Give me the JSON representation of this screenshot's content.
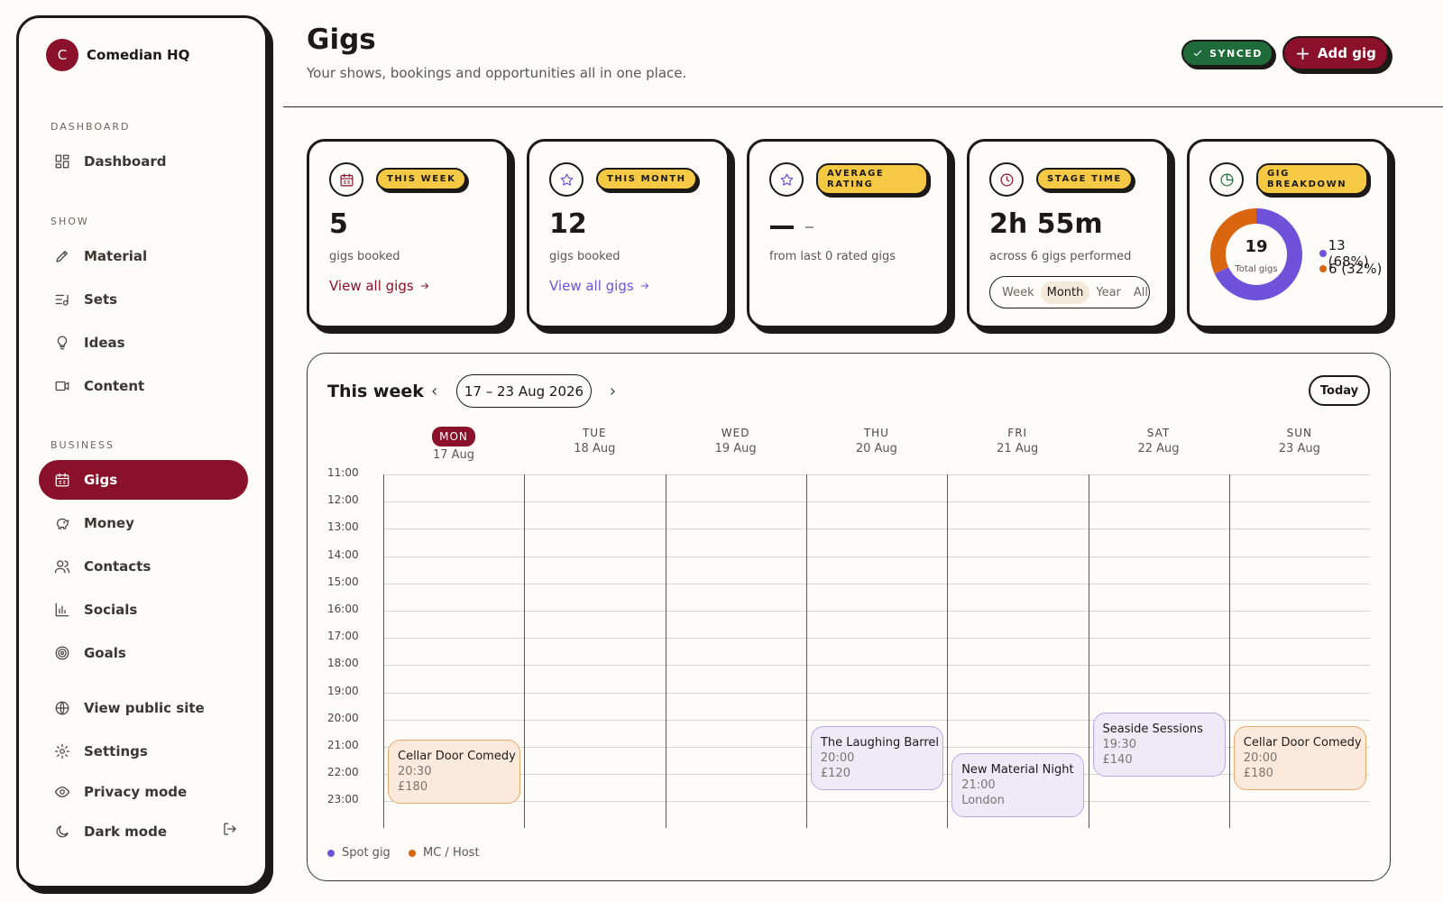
{
  "brand": {
    "initial": "C",
    "name": "Comedian HQ"
  },
  "sidebar": {
    "sections": {
      "dashboard": "DASHBOARD",
      "show": "SHOW",
      "business": "BUSINESS"
    },
    "items": {
      "dashboard": "Dashboard",
      "material": "Material",
      "sets": "Sets",
      "ideas": "Ideas",
      "content": "Content",
      "gigs": "Gigs",
      "money": "Money",
      "contacts": "Contacts",
      "socials": "Socials",
      "goals": "Goals",
      "public_site": "View public site",
      "settings": "Settings",
      "privacy": "Privacy mode",
      "dark": "Dark mode"
    },
    "active": "gigs"
  },
  "header": {
    "title": "Gigs",
    "subtitle": "Your shows, bookings and opportunities all in one place.",
    "synced": "SYNCED",
    "add_gig": "Add gig"
  },
  "cards": {
    "week": {
      "badge": "THIS WEEK",
      "value": "5",
      "sub": "gigs booked",
      "link": "View all gigs"
    },
    "month": {
      "badge": "THIS MONTH",
      "value": "12",
      "sub": "gigs booked",
      "link": "View all gigs"
    },
    "rating": {
      "badge_line1": "AVERAGE",
      "badge_line2": "RATING",
      "sub": "from last 0 rated gigs"
    },
    "stage": {
      "badge": "STAGE TIME",
      "value": "2h 55m",
      "sub": "across 6 gigs performed",
      "periods": [
        "Week",
        "Month",
        "Year",
        "All"
      ],
      "selected_period": "Month"
    },
    "breakdown": {
      "badge_line1": "GIG",
      "badge_line2": "BREAKDOWN",
      "total": "19",
      "total_label": "Total gigs",
      "segments": [
        {
          "label": "13 (68%)",
          "fraction": 0.68,
          "color": "#6f52d9"
        },
        {
          "label": "6 (32%)",
          "fraction": 0.32,
          "color": "#d9650f"
        }
      ]
    }
  },
  "calendar": {
    "title": "This week",
    "range": "17 – 23 Aug 2026",
    "today_label": "Today",
    "days": [
      {
        "name": "MON",
        "date": "17 Aug",
        "today": true
      },
      {
        "name": "TUE",
        "date": "18 Aug",
        "today": false
      },
      {
        "name": "WED",
        "date": "19 Aug",
        "today": false
      },
      {
        "name": "THU",
        "date": "20 Aug",
        "today": false
      },
      {
        "name": "FRI",
        "date": "21 Aug",
        "today": false
      },
      {
        "name": "SAT",
        "date": "22 Aug",
        "today": false
      },
      {
        "name": "SUN",
        "date": "23 Aug",
        "today": false
      }
    ],
    "hours": [
      "11:00",
      "12:00",
      "13:00",
      "14:00",
      "15:00",
      "16:00",
      "17:00",
      "18:00",
      "19:00",
      "20:00",
      "21:00",
      "22:00",
      "23:00"
    ],
    "events": [
      {
        "day": 0,
        "start": 20.5,
        "type": "mc",
        "title": "Cellar Door Comedy",
        "lines": [
          "20:30",
          "£180"
        ]
      },
      {
        "day": 3,
        "start": 20.0,
        "type": "spot",
        "title": "The Laughing Barrel",
        "lines": [
          "20:00",
          "£120"
        ]
      },
      {
        "day": 4,
        "start": 21.0,
        "type": "spot",
        "title": "New Material Night",
        "lines": [
          "21:00",
          "London"
        ]
      },
      {
        "day": 5,
        "start": 19.5,
        "type": "spot",
        "title": "Seaside Sessions",
        "lines": [
          "19:30",
          "£140"
        ]
      },
      {
        "day": 6,
        "start": 20.0,
        "type": "mc",
        "title": "Cellar Door Comedy",
        "lines": [
          "20:00",
          "£180"
        ]
      }
    ],
    "legend": {
      "spot": "Spot gig",
      "mc": "MC / Host"
    }
  },
  "colors": {
    "primary": "#8b1029",
    "accent": "#f6c945",
    "synced": "#1f6b3a",
    "spot": "#6f52d9",
    "mc": "#d9650f"
  }
}
